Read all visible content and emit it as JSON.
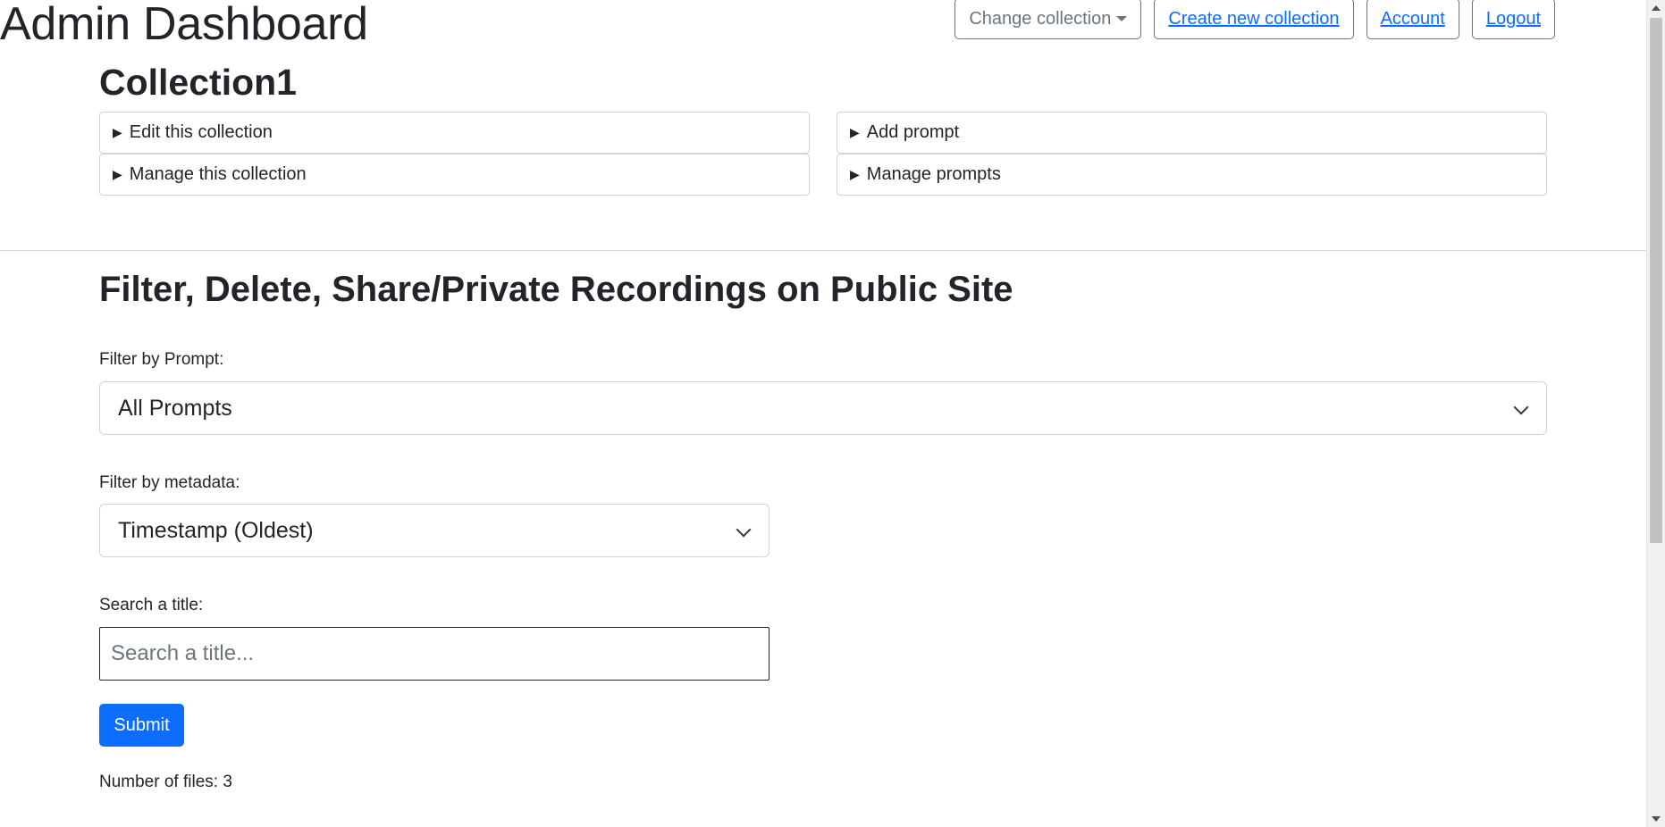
{
  "header": {
    "app_title": "Admin Dashboard",
    "nav": {
      "change_collection": "Change collection",
      "create_collection": "Create new collection",
      "account": "Account",
      "logout": "Logout"
    }
  },
  "collection": {
    "title": "Collection1",
    "panels": {
      "edit": "Edit this collection",
      "add_prompt": "Add prompt",
      "manage": "Manage this collection",
      "manage_prompts": "Manage prompts"
    }
  },
  "filters": {
    "section_title": "Filter, Delete, Share/Private Recordings on Public Site",
    "prompt_label": "Filter by Prompt:",
    "prompt_selected": "All Prompts",
    "metadata_label": "Filter by metadata:",
    "metadata_selected": "Timestamp (Oldest)",
    "search_label": "Search a title:",
    "search_placeholder": "Search a title...",
    "search_value": "",
    "submit_label": "Submit"
  },
  "results": {
    "file_count_text": "Number of files: 3"
  },
  "colors": {
    "primary": "#0d6efd",
    "secondary": "#6c757d",
    "text": "#212529"
  }
}
